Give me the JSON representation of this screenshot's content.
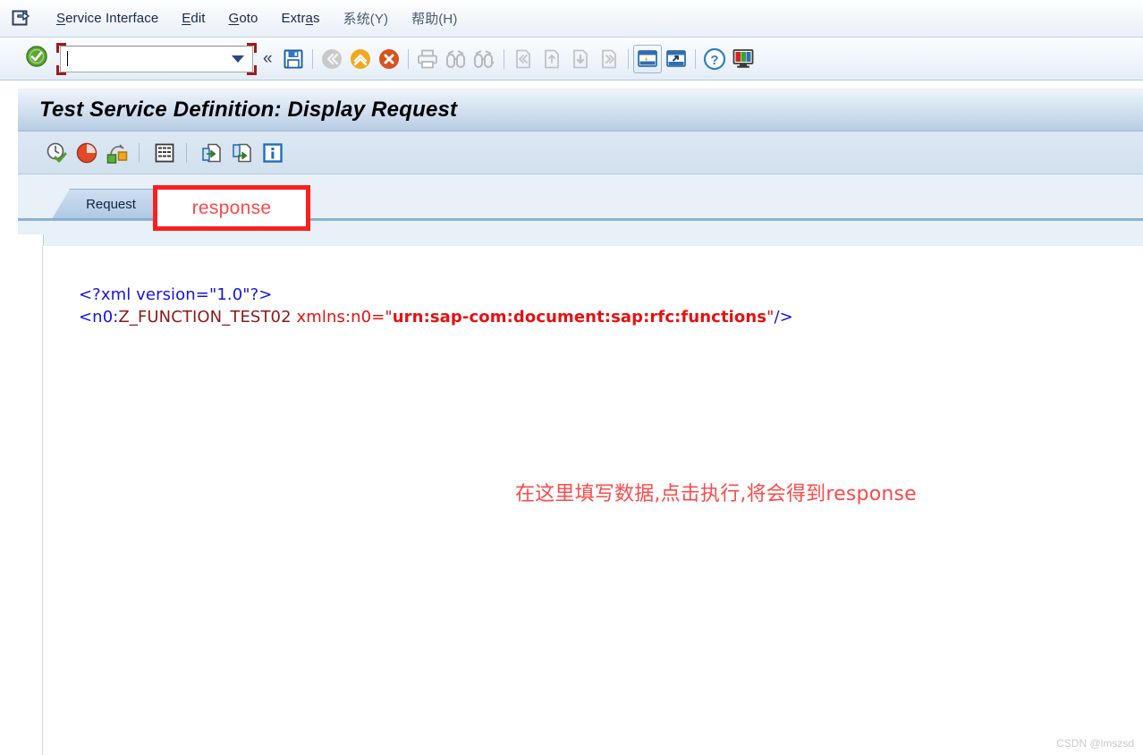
{
  "app": {
    "title": "Test Service Definition: Display Request",
    "system_icon": "sap-system-menu-icon"
  },
  "menubar": {
    "items": [
      {
        "label": "Service Interface",
        "accel": "S",
        "lang": "en"
      },
      {
        "label": "Edit",
        "accel": "E",
        "lang": "en"
      },
      {
        "label": "Goto",
        "accel": "G",
        "lang": "en"
      },
      {
        "label": "Extras",
        "accel": "a",
        "lang": "en"
      },
      {
        "label": "系统(Y)",
        "accel": "Y",
        "lang": "cn"
      },
      {
        "label": "帮助(H)",
        "accel": "H",
        "lang": "cn"
      }
    ]
  },
  "toolbar": {
    "enter_icon": "green-check-enter-icon",
    "command_field": {
      "value": "",
      "placeholder": "",
      "dropdown_icon": "chevron-down-icon",
      "annotation": "red-corner-brackets"
    },
    "collapse_icon": "double-chevron-left-icon",
    "buttons": [
      {
        "name": "save-button",
        "icon": "floppy-disk-icon",
        "enabled": true
      },
      {
        "name": "back-button",
        "icon": "back-arrow-icon",
        "enabled": false
      },
      {
        "name": "exit-button",
        "icon": "exit-up-arrow-icon",
        "enabled": true
      },
      {
        "name": "cancel-button",
        "icon": "cancel-x-icon",
        "enabled": true
      },
      {
        "name": "print-button",
        "icon": "printer-icon",
        "enabled": false
      },
      {
        "name": "find-button",
        "icon": "binoculars-icon",
        "enabled": false
      },
      {
        "name": "find-next-button",
        "icon": "binoculars-plus-icon",
        "enabled": false
      },
      {
        "name": "first-page-button",
        "icon": "first-page-icon",
        "enabled": false
      },
      {
        "name": "previous-page-button",
        "icon": "previous-page-icon",
        "enabled": false
      },
      {
        "name": "next-page-button",
        "icon": "next-page-icon",
        "enabled": false
      },
      {
        "name": "last-page-button",
        "icon": "last-page-icon",
        "enabled": false
      },
      {
        "name": "customize-layout-button",
        "icon": "customize-local-layout-icon",
        "enabled": true
      },
      {
        "name": "create-shortcut-button",
        "icon": "create-shortcut-icon",
        "enabled": true
      },
      {
        "name": "help-button",
        "icon": "question-mark-help-icon",
        "enabled": true
      },
      {
        "name": "gui-settings-button",
        "icon": "monitor-settings-icon",
        "enabled": true
      }
    ]
  },
  "app_toolbar": {
    "buttons": [
      {
        "name": "execute-button",
        "icon": "clock-check-execute-icon"
      },
      {
        "name": "stop-button",
        "icon": "red-stop-ball-icon"
      },
      {
        "name": "connection-button",
        "icon": "connect-nodes-icon"
      },
      {
        "name": "table-view-button",
        "icon": "grid-table-icon"
      },
      {
        "name": "import-xml-button",
        "icon": "document-green-arrow-in-icon"
      },
      {
        "name": "export-xml-button",
        "icon": "document-green-arrow-out-icon"
      },
      {
        "name": "information-button",
        "icon": "blue-info-icon"
      }
    ]
  },
  "tabs": {
    "items": [
      {
        "label": "Request",
        "active": true
      }
    ]
  },
  "annotations": {
    "response_box": {
      "text": "response",
      "color": "#fb4a4a",
      "border_color": "#fb1f1f"
    },
    "chinese_note": {
      "text": "在这里填写数据,点击执行,将会得到response",
      "color": "#fb4a4a"
    }
  },
  "editor": {
    "line1": "<?xml version=\"1.0\"?>",
    "line2_parts": {
      "open": "<n0:",
      "element": "Z_FUNCTION_TEST02",
      "space": " ",
      "attr": "xmlns:n0",
      "eq": "=",
      "quote_open": "\"",
      "value": "urn:sap-com:document:sap:rfc:functions",
      "quote_close": "\"",
      "close": "/>"
    }
  },
  "watermark": {
    "text": "CSDN @lmszsd"
  }
}
